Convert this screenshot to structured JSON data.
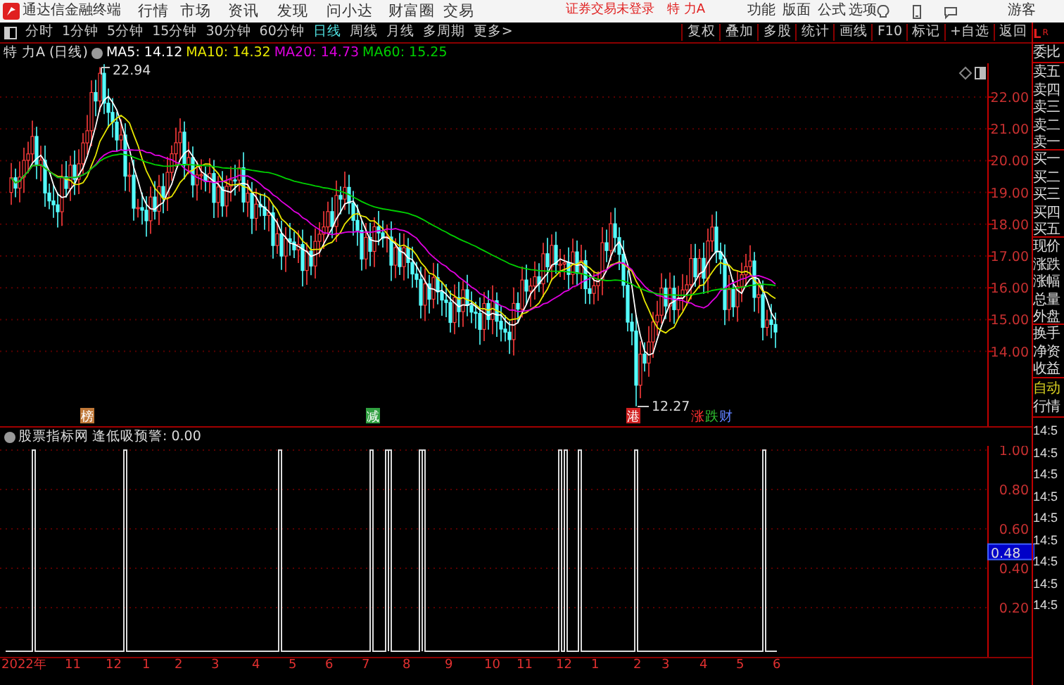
{
  "app": {
    "title": "通达信金融终端"
  },
  "menu": [
    "行情",
    "市场",
    "资讯",
    "发现",
    "问小达",
    "财富圈",
    "交易"
  ],
  "login_status": "证券交易未登录",
  "header_stock": "特 力A",
  "top_actions": [
    "功能",
    "版面",
    "公式",
    "选项"
  ],
  "user": "游客",
  "period_tabs": [
    {
      "label": "分时",
      "selected": false
    },
    {
      "label": "1分钟",
      "selected": false
    },
    {
      "label": "5分钟",
      "selected": false
    },
    {
      "label": "15分钟",
      "selected": false
    },
    {
      "label": "30分钟",
      "selected": false
    },
    {
      "label": "60分钟",
      "selected": false
    },
    {
      "label": "日线",
      "selected": true
    },
    {
      "label": "周线",
      "selected": false
    },
    {
      "label": "月线",
      "selected": false
    },
    {
      "label": "多周期",
      "selected": false
    },
    {
      "label": "更多>",
      "selected": false
    }
  ],
  "chart_tools": [
    "复权",
    "叠加",
    "多股",
    "统计",
    "画线",
    "F10",
    "标记",
    "+自选",
    "返回"
  ],
  "chart_info": {
    "title": "特 力A (日线)",
    "ma": [
      {
        "label": "MA5: 14.12",
        "color": "#ffffff"
      },
      {
        "label": "MA10: 14.32",
        "color": "#e8e800"
      },
      {
        "label": "MA20: 14.73",
        "color": "#e000e0"
      },
      {
        "label": "MA60: 15.25",
        "color": "#00d000"
      }
    ]
  },
  "price_axis": [
    "22.00",
    "21.00",
    "20.00",
    "19.00",
    "18.00",
    "17.00",
    "16.00",
    "15.00",
    "14.00"
  ],
  "high_label": "22.94",
  "low_label": "12.27",
  "event_markers": [
    {
      "label": "榜",
      "color": "#c07838"
    },
    {
      "label": "减",
      "color": "#30a040"
    },
    {
      "label": "港",
      "color": "#d02020"
    },
    {
      "label": "涨",
      "color": "#ff3030"
    },
    {
      "label": "跌",
      "color": "#30c030"
    },
    {
      "label": "财",
      "color": "#6080ff"
    }
  ],
  "indicator": {
    "name": "股票指标网",
    "label": "逢低吸预警: 0.00"
  },
  "indicator_axis": [
    "1.00",
    "0.80",
    "0.60",
    "0.40",
    "0.20"
  ],
  "cursor_value": "0.48",
  "time_axis": [
    "2022年",
    "11",
    "12",
    "1",
    "2",
    "3",
    "4",
    "5",
    "6",
    "7",
    "8",
    "9",
    "10",
    "11",
    "12",
    "1",
    "2",
    "3",
    "4",
    "5",
    "6"
  ],
  "corner_labels": [
    "L",
    "R"
  ],
  "quote_groups": [
    [
      "委比"
    ],
    [
      "卖五",
      "卖四",
      "卖三",
      "卖二",
      "卖一"
    ],
    [
      "买一",
      "买二",
      "买三",
      "买四",
      "买五"
    ],
    [
      "现价",
      "涨跌",
      "涨幅",
      "总量",
      "外盘"
    ],
    [
      "换手",
      "净资",
      "收益"
    ]
  ],
  "quote_tabs": [
    "自动",
    "行情"
  ],
  "trade_times": [
    "14:5",
    "14:5",
    "14:5",
    "14:5",
    "14:5",
    "14:5",
    "14:5",
    "14:5",
    "14:5"
  ]
}
